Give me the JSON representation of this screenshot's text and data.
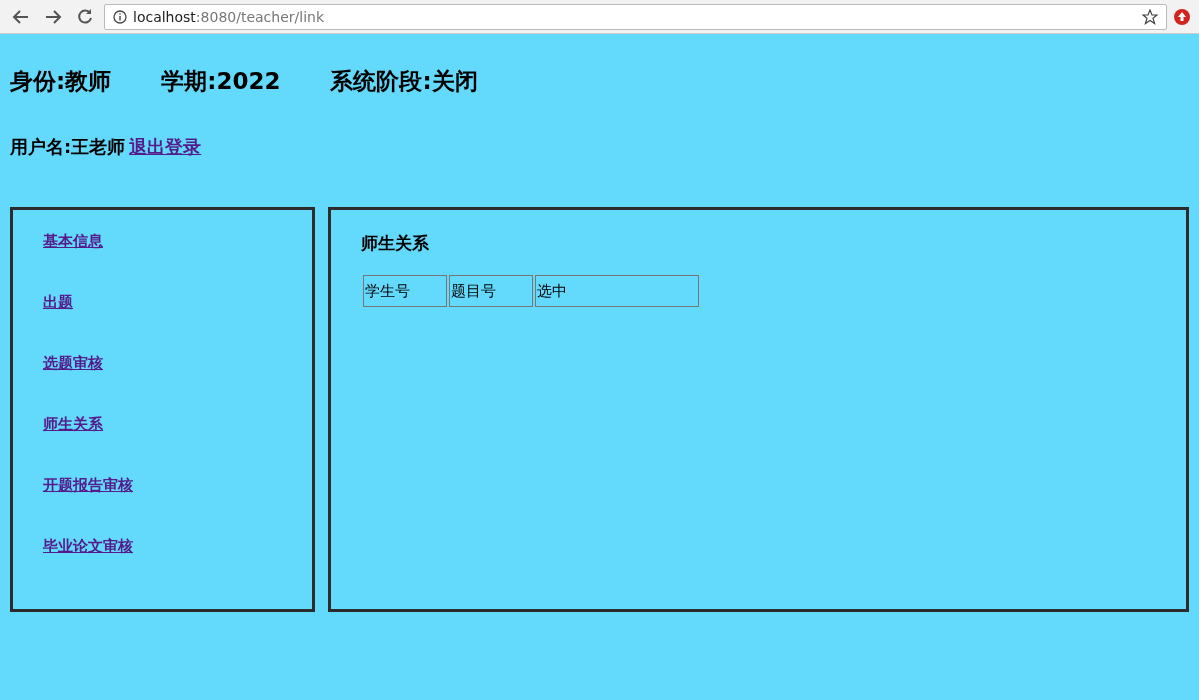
{
  "browser": {
    "url_host": "localhost",
    "url_path": ":8080/teacher/link"
  },
  "header": {
    "items": [
      "身份:教师",
      "学期:2022",
      "系统阶段:关闭"
    ]
  },
  "user": {
    "label": "用户名:王老师",
    "logout": "退出登录"
  },
  "sidebar": {
    "items": [
      {
        "label": "基本信息"
      },
      {
        "label": "出题"
      },
      {
        "label": "选题审核"
      },
      {
        "label": "师生关系"
      },
      {
        "label": "开题报告审核"
      },
      {
        "label": "毕业论文审核"
      }
    ]
  },
  "content": {
    "title": "师生关系",
    "table": {
      "columns": [
        "学生号",
        "题目号",
        "选中"
      ]
    }
  }
}
